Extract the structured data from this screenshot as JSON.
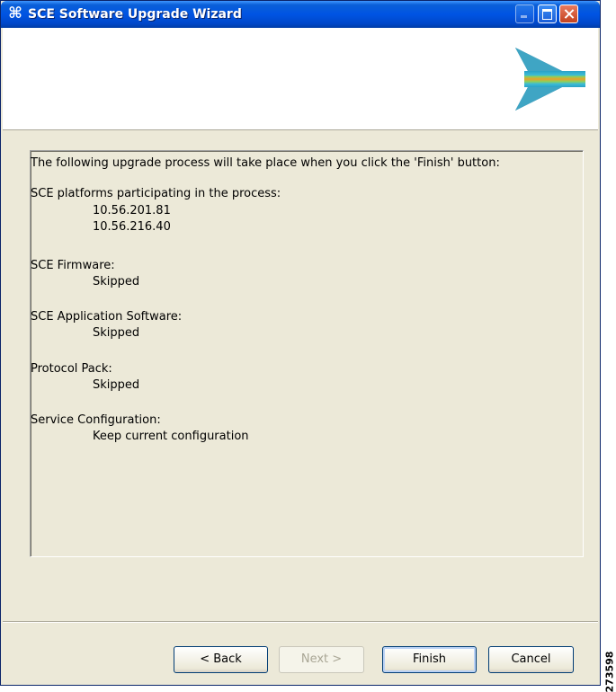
{
  "window": {
    "title": "SCE Software Upgrade Wizard",
    "icon": "cisco-wizard-icon",
    "colors": {
      "titlebar": "#0054e3",
      "face": "#ece9d8",
      "close": "#c4421f"
    }
  },
  "summary": {
    "intro": "The following upgrade process will take place when you click the 'Finish' button:",
    "platforms_label": "SCE platforms participating in the process:",
    "platforms": [
      "10.56.201.81",
      "10.56.216.40"
    ],
    "firmware_label": "SCE Firmware:",
    "firmware_value": "Skipped",
    "app_software_label": "SCE Application Software:",
    "app_software_value": "Skipped",
    "protocol_pack_label": "Protocol Pack:",
    "protocol_pack_value": "Skipped",
    "service_config_label": "Service Configuration:",
    "service_config_value": "Keep current configuration"
  },
  "buttons": {
    "back": "< Back",
    "next": "Next >",
    "finish": "Finish",
    "cancel": "Cancel"
  },
  "figure_id": "273598"
}
